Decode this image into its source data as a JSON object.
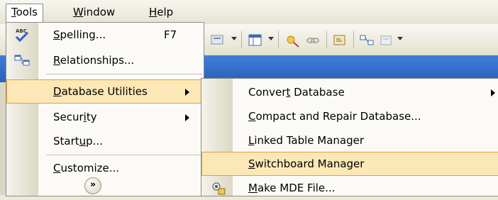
{
  "menubar": {
    "tools": {
      "mn": "T",
      "rest": "ools"
    },
    "window": {
      "mn": "W",
      "rest": "indow"
    },
    "help": {
      "mn": "H",
      "rest": "elp"
    }
  },
  "tools_menu": {
    "spelling": {
      "pre": "",
      "mn": "S",
      "post": "pelling...",
      "shortcut": "F7"
    },
    "relationships": {
      "pre": "",
      "mn": "R",
      "post": "elationships..."
    },
    "database_utilities": {
      "pre": "",
      "mn": "D",
      "post": "atabase Utilities"
    },
    "security": {
      "pre": "Secur",
      "mn": "i",
      "post": "ty"
    },
    "startup": {
      "pre": "Start",
      "mn": "u",
      "post": "p..."
    },
    "customize": {
      "pre": "",
      "mn": "C",
      "post": "ustomize..."
    }
  },
  "db_utilities_submenu": {
    "convert": {
      "pre": "Conver",
      "mn": "t",
      "post": " Database"
    },
    "compact": {
      "pre": "",
      "mn": "C",
      "post": "ompact and Repair Database..."
    },
    "linked": {
      "pre": "",
      "mn": "L",
      "post": "inked Table Manager"
    },
    "switchboard": {
      "pre": "",
      "mn": "S",
      "post": "witchboard Manager"
    },
    "make_mde": {
      "pre": "",
      "mn": "M",
      "post": "ake MDE File..."
    }
  },
  "colors": {
    "highlight": "#fce7b6",
    "highlight_border": "#d9a43d",
    "title_blue": "#2a5fb8"
  },
  "icons": [
    "spelling-icon",
    "relationships-icon",
    "expand-chevron-icon",
    "make-mde-icon"
  ]
}
